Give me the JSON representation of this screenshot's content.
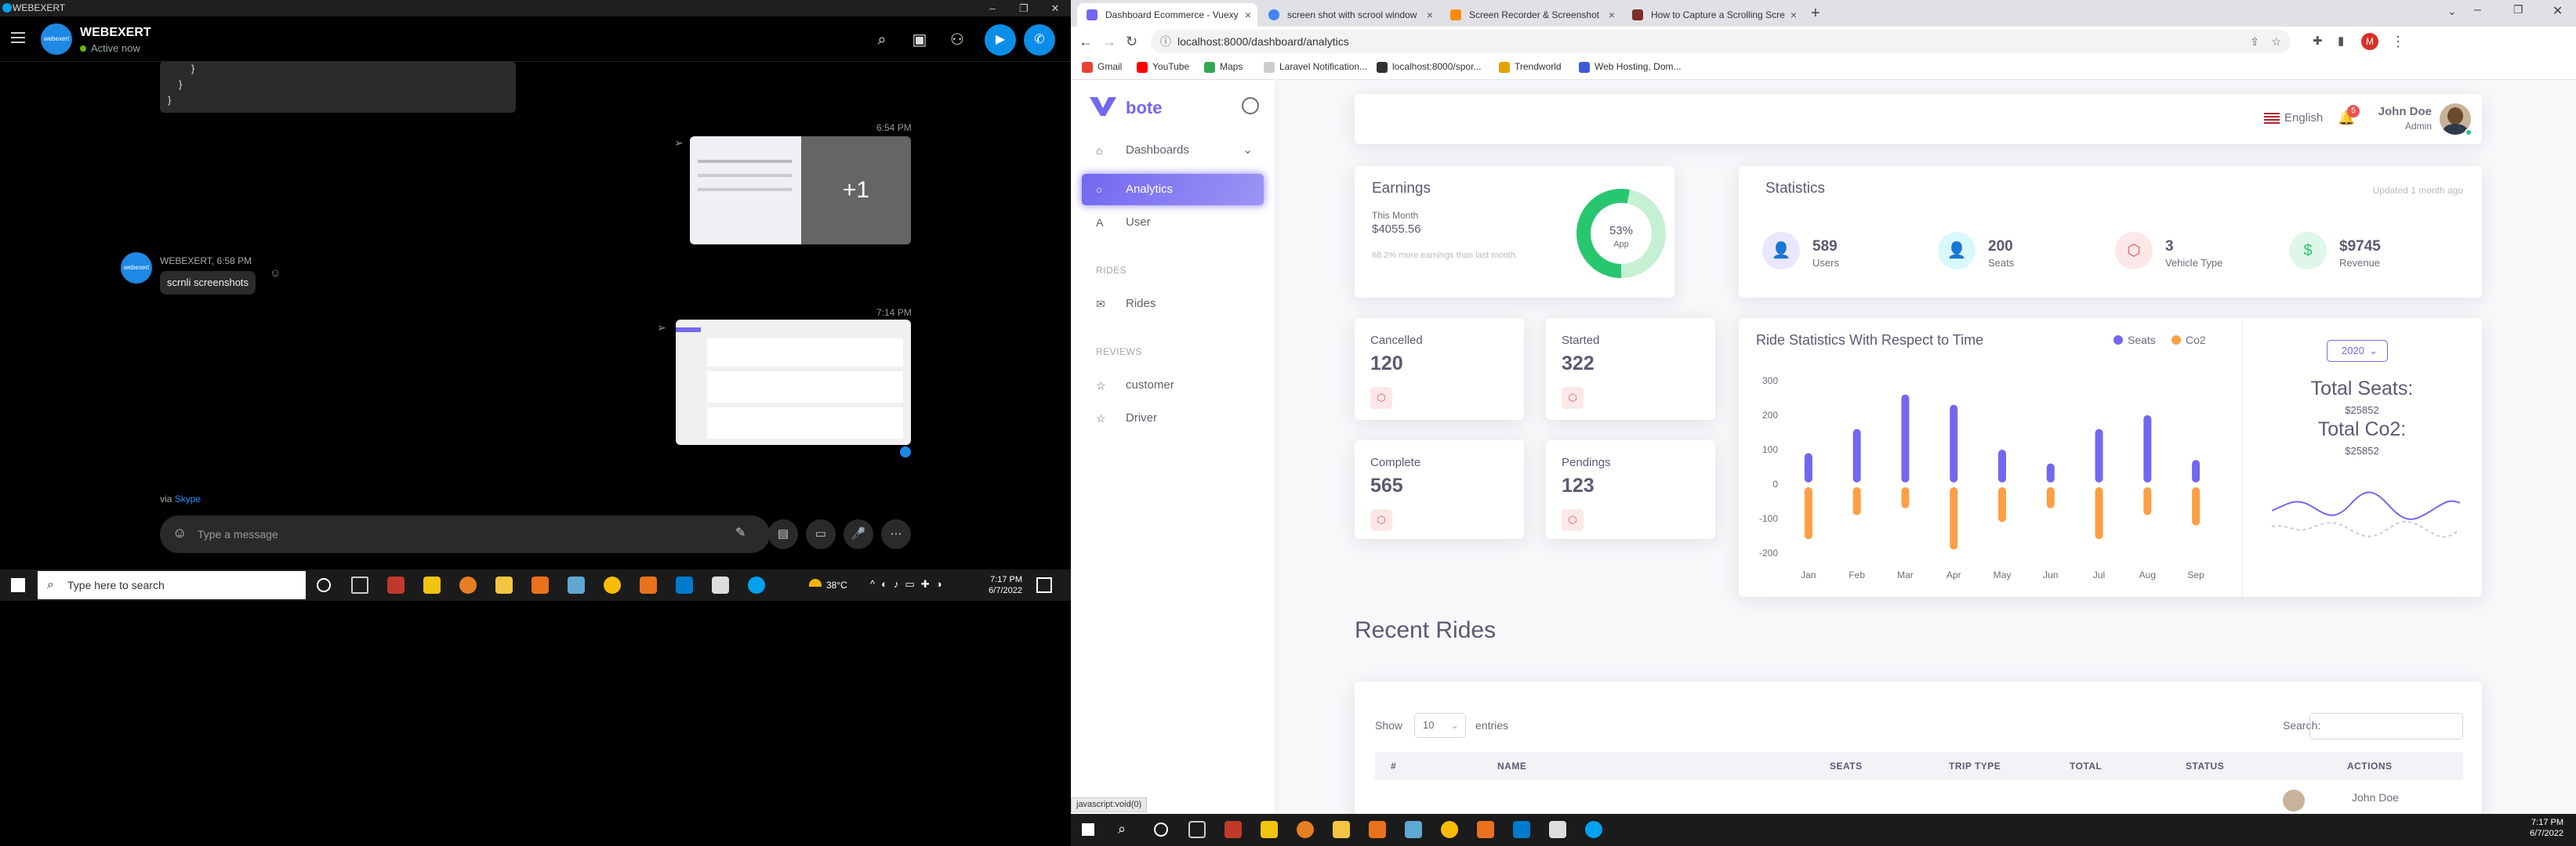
{
  "skype": {
    "window_title": "WEBEXERT",
    "contact_name": "WEBEXERT",
    "avatar_text": "webexert",
    "status": "Active now",
    "code_lines": [
      "}",
      "}",
      "}"
    ],
    "time_1": "6:54 PM",
    "more_count": "+1",
    "sender_line": "WEBEXERT, 6:58 PM",
    "message_text": "scrnli screenshots",
    "time_2": "7:14 PM",
    "via_prefix": "via",
    "via_link": "Skype",
    "message_placeholder": "Type a message"
  },
  "taskbar_left": {
    "search_placeholder": "Type here to search",
    "weather": "38°C",
    "time": "7:17 PM",
    "date": "6/7/2022"
  },
  "taskbar_right": {
    "time": "7:17 PM",
    "date": "6/7/2022"
  },
  "browser": {
    "tabs": [
      {
        "label": "Dashboard Ecommerce - Vuexy",
        "color": "#7367f0"
      },
      {
        "label": "screen shot with scrool window",
        "color": "#4285f4"
      },
      {
        "label": "Screen Recorder & Screenshot",
        "color": "#ff8a00"
      },
      {
        "label": "How to Capture a Scrolling Scre",
        "color": "#7b2d26"
      }
    ],
    "url": "localhost:8000/dashboard/analytics",
    "bookmarks": [
      {
        "label": "Gmail",
        "color": "#ea4335"
      },
      {
        "label": "YouTube",
        "color": "#ff0000"
      },
      {
        "label": "Maps",
        "color": "#34a853"
      },
      {
        "label": "Laravel Notification...",
        "color": "#cccccc"
      },
      {
        "label": "localhost:8000/spor...",
        "color": "#333333"
      },
      {
        "label": "Trendworld",
        "color": "#e6a100"
      },
      {
        "label": "Web Hosting, Dom...",
        "color": "#3b5bdb"
      }
    ],
    "status_link": "javascript:void(0)",
    "profile_initial": "M"
  },
  "app": {
    "brand": "bote",
    "nav": {
      "dashboards": "Dashboards",
      "analytics": "Analytics",
      "user": "User",
      "rides_header": "RIDES",
      "rides": "Rides",
      "reviews_header": "REVIEWS",
      "customer": "customer",
      "driver": "Driver"
    },
    "navbar": {
      "language": "English",
      "notification_count": "5",
      "user_name": "John Doe",
      "user_role": "Admin"
    },
    "earnings": {
      "title": "Earnings",
      "period": "This Month",
      "amount": "$4055.56",
      "note": "68.2% more earnings than last month.",
      "donut_percent": "53%",
      "donut_label": "App",
      "donut_value": 0.53
    },
    "statistics": {
      "title": "Statistics",
      "updated": "Updated 1 month ago",
      "items": [
        {
          "value": "589",
          "label": "Users",
          "icon": "user-icon",
          "glyph": "👤",
          "bg": "#e9e7fd",
          "fg": "#7367f0"
        },
        {
          "value": "200",
          "label": "Seats",
          "icon": "user-seat-icon",
          "glyph": "👤",
          "bg": "#d9f8fc",
          "fg": "#00cfe8"
        },
        {
          "value": "3",
          "label": "Vehicle Type",
          "icon": "box-icon",
          "glyph": "⬡",
          "bg": "#fce8e8",
          "fg": "#ea5455"
        },
        {
          "value": "$9745",
          "label": "Revenue",
          "icon": "dollar-icon",
          "glyph": "$",
          "bg": "#dff7e9",
          "fg": "#28c76f"
        }
      ]
    },
    "mini_cards": [
      {
        "label": "Cancelled",
        "value": "120"
      },
      {
        "label": "Started",
        "value": "322"
      },
      {
        "label": "Complete",
        "value": "565"
      },
      {
        "label": "Pendings",
        "value": "123"
      }
    ],
    "ride_stats": {
      "title": "Ride Statistics With Respect to Time",
      "year": "2020",
      "total_seats_label": "Total Seats:",
      "total_seats_value": "$25852",
      "total_co2_label": "Total Co2:",
      "total_co2_value": "$25852"
    },
    "recent_rides": {
      "title": "Recent Rides",
      "show_label": "Show",
      "show_value": "10",
      "entries_label": "entries",
      "search_label": "Search:",
      "columns": [
        "#",
        "NAME",
        "SEATS",
        "TRIP TYPE",
        "TOTAL",
        "STATUS",
        "ACTIONS"
      ],
      "first_row_name": "John Doe"
    }
  },
  "chart_data": {
    "type": "bar",
    "categories": [
      "Jan",
      "Feb",
      "Mar",
      "Apr",
      "May",
      "Jun",
      "Jul",
      "Aug",
      "Sep"
    ],
    "series": [
      {
        "name": "Seats",
        "values": [
          90,
          160,
          260,
          230,
          100,
          60,
          160,
          200,
          70
        ],
        "color": "#7367f0"
      },
      {
        "name": "Co2",
        "values": [
          -160,
          -90,
          -70,
          -190,
          -110,
          -70,
          -160,
          -90,
          -120
        ],
        "color": "#ff9f43"
      }
    ],
    "y_ticks": [
      300,
      200,
      100,
      0,
      -100,
      -200
    ],
    "ylim": [
      -200,
      300
    ],
    "legend_position": "top-right"
  }
}
